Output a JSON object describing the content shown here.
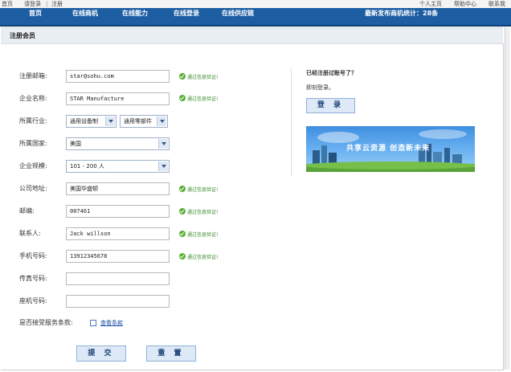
{
  "topbar": {
    "left": [
      "首页",
      "请登录",
      "注册"
    ],
    "right": [
      "个人主页",
      "帮助中心",
      "联系我"
    ]
  },
  "nav": {
    "items": [
      "首页",
      "在线商机",
      "在线能力",
      "在线登录",
      "在线供应链"
    ],
    "stats": "最新发布商机统计：28条"
  },
  "panel_title": "注册会员",
  "form": {
    "email": {
      "label": "注册邮箱:",
      "value": "star@sohu.com"
    },
    "company": {
      "label": "企业名称:",
      "value": "STAR Manufacture"
    },
    "industry": {
      "label": "所属行业:",
      "value1": "通用设备制",
      "value2": "通用零部件"
    },
    "country": {
      "label": "所属国家:",
      "value": "美国"
    },
    "scale": {
      "label": "企业规模:",
      "value": "101 - 200 人"
    },
    "address": {
      "label": "公司地址:",
      "value": "美国华盛顿"
    },
    "zip": {
      "label": "邮编:",
      "value": "007461"
    },
    "contact": {
      "label": "联系人:",
      "value": "Jack willson"
    },
    "mobile": {
      "label": "手机号码:",
      "value": "13912345678"
    },
    "fax": {
      "label": "传真号码:",
      "value": ""
    },
    "phone": {
      "label": "座机号码:",
      "value": ""
    },
    "terms": {
      "label": "是否接受服务条款:",
      "link": "查看条款"
    },
    "verify_text": "通过信息验证!",
    "submit_label": "提 交",
    "reset_label": "重 置"
  },
  "login_box": {
    "title": "已经注册过账号了？",
    "subtitle": "即刻登录。",
    "login_label": "登 录"
  },
  "banner": {
    "text": "共享云资源 创造新未来"
  }
}
